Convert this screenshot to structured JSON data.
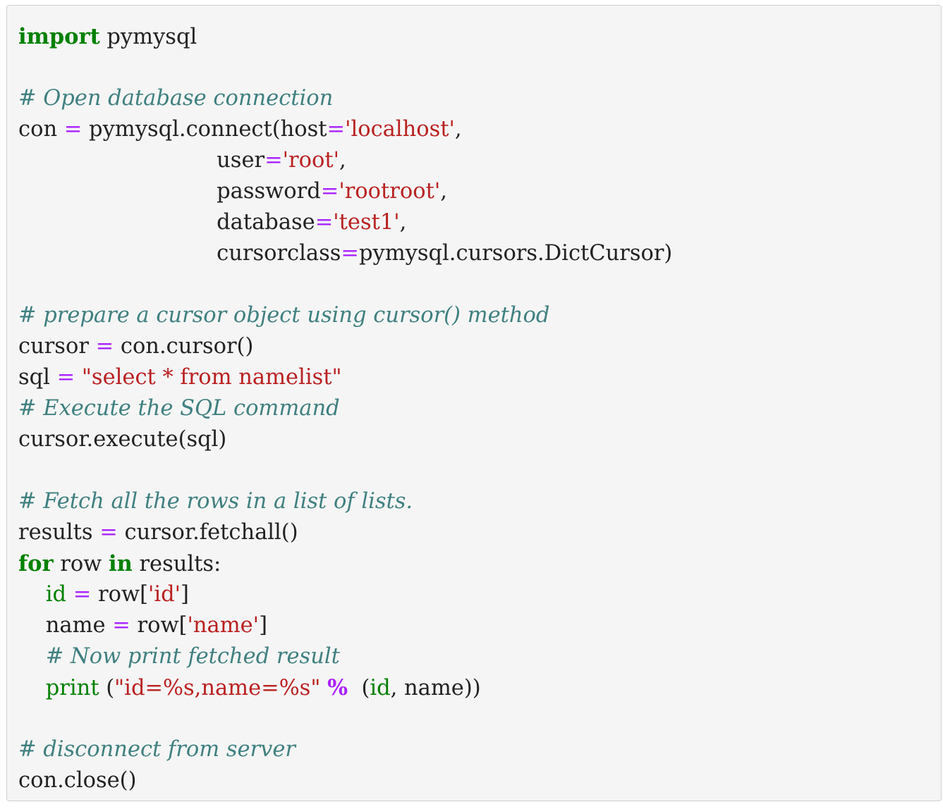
{
  "code_block": {
    "lines": [
      [
        {
          "t": "import",
          "k": "kw"
        },
        {
          "t": " pymysql",
          "k": "id"
        }
      ],
      [],
      [
        {
          "t": "# Open database connection",
          "k": "cm"
        }
      ],
      [
        {
          "t": "con ",
          "k": "id"
        },
        {
          "t": "=",
          "k": "op"
        },
        {
          "t": " pymysql.connect(host",
          "k": "id"
        },
        {
          "t": "=",
          "k": "op"
        },
        {
          "t": "'localhost'",
          "k": "str"
        },
        {
          "t": ",",
          "k": "id"
        }
      ],
      [
        {
          "t": "                             user",
          "k": "id"
        },
        {
          "t": "=",
          "k": "op"
        },
        {
          "t": "'root'",
          "k": "str"
        },
        {
          "t": ",",
          "k": "id"
        }
      ],
      [
        {
          "t": "                             password",
          "k": "id"
        },
        {
          "t": "=",
          "k": "op"
        },
        {
          "t": "'rootroot'",
          "k": "str"
        },
        {
          "t": ",",
          "k": "id"
        }
      ],
      [
        {
          "t": "                             database",
          "k": "id"
        },
        {
          "t": "=",
          "k": "op"
        },
        {
          "t": "'test1'",
          "k": "str"
        },
        {
          "t": ",",
          "k": "id"
        }
      ],
      [
        {
          "t": "                             cursorclass",
          "k": "id"
        },
        {
          "t": "=",
          "k": "op"
        },
        {
          "t": "pymysql.cursors.DictCursor)",
          "k": "id"
        }
      ],
      [],
      [
        {
          "t": "# prepare a cursor object using cursor() method",
          "k": "cm"
        }
      ],
      [
        {
          "t": "cursor ",
          "k": "id"
        },
        {
          "t": "=",
          "k": "op"
        },
        {
          "t": " con.cursor()",
          "k": "id"
        }
      ],
      [
        {
          "t": "sql ",
          "k": "id"
        },
        {
          "t": "=",
          "k": "op"
        },
        {
          "t": " ",
          "k": "id"
        },
        {
          "t": "\"select * from namelist\"",
          "k": "str"
        }
      ],
      [
        {
          "t": "# Execute the SQL command",
          "k": "cm"
        }
      ],
      [
        {
          "t": "cursor.execute(sql)",
          "k": "id"
        }
      ],
      [],
      [
        {
          "t": "# Fetch all the rows in a list of lists.",
          "k": "cm"
        }
      ],
      [
        {
          "t": "results ",
          "k": "id"
        },
        {
          "t": "=",
          "k": "op"
        },
        {
          "t": " cursor.fetchall()",
          "k": "id"
        }
      ],
      [
        {
          "t": "for",
          "k": "kw"
        },
        {
          "t": " row ",
          "k": "id"
        },
        {
          "t": "in",
          "k": "kw"
        },
        {
          "t": " results:",
          "k": "id"
        }
      ],
      [
        {
          "t": "    ",
          "k": "id"
        },
        {
          "t": "id",
          "k": "bi"
        },
        {
          "t": " ",
          "k": "id"
        },
        {
          "t": "=",
          "k": "op"
        },
        {
          "t": " row[",
          "k": "id"
        },
        {
          "t": "'id'",
          "k": "str"
        },
        {
          "t": "]",
          "k": "id"
        }
      ],
      [
        {
          "t": "    name ",
          "k": "id"
        },
        {
          "t": "=",
          "k": "op"
        },
        {
          "t": " row[",
          "k": "id"
        },
        {
          "t": "'name'",
          "k": "str"
        },
        {
          "t": "]",
          "k": "id"
        }
      ],
      [
        {
          "t": "    ",
          "k": "id"
        },
        {
          "t": "# Now print fetched result",
          "k": "cm"
        }
      ],
      [
        {
          "t": "    ",
          "k": "id"
        },
        {
          "t": "print",
          "k": "bi"
        },
        {
          "t": " (",
          "k": "id"
        },
        {
          "t": "\"id=%s,name=%s\"",
          "k": "str"
        },
        {
          "t": " ",
          "k": "id"
        },
        {
          "t": "%",
          "k": "opb"
        },
        {
          "t": "  (",
          "k": "id"
        },
        {
          "t": "id",
          "k": "bi"
        },
        {
          "t": ", name))",
          "k": "id"
        }
      ],
      [],
      [
        {
          "t": "# disconnect from server",
          "k": "cm"
        }
      ],
      [
        {
          "t": "con.close()",
          "k": "id"
        }
      ]
    ]
  }
}
